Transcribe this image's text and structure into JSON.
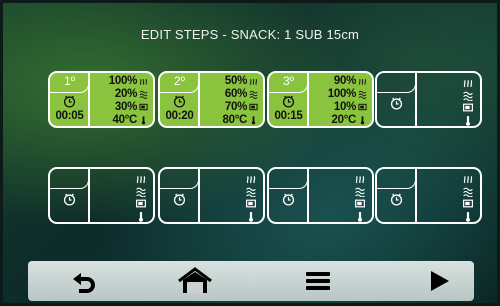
{
  "title": "EDIT STEPS - SNACK: 1 SUB 15cm",
  "steps": [
    {
      "num": "1º",
      "time": "00:05",
      "v1": "100%",
      "v2": "20%",
      "v3": "30%",
      "v4": "40°C"
    },
    {
      "num": "2º",
      "time": "00:20",
      "v1": "50%",
      "v2": "60%",
      "v3": "70%",
      "v4": "80°C"
    },
    {
      "num": "3º",
      "time": "00:15",
      "v1": "90%",
      "v2": "100%",
      "v3": "10%",
      "v4": "20°C"
    }
  ],
  "empty_steps_count_visible": 5,
  "icons": {
    "timer": "clock-icon",
    "heat": "heat-waves-icon",
    "steam": "steam-icon",
    "microwave": "microwave-icon",
    "temperature": "thermometer-icon"
  },
  "nav": {
    "back": "back-arrow-icon",
    "home": "home-icon",
    "menu": "menu-icon",
    "play": "play-icon"
  },
  "colors": {
    "step_fill": "#8ac43f",
    "outline": "#ffffff",
    "navbar": "#c8d3d1",
    "nav_icon": "#000000"
  }
}
